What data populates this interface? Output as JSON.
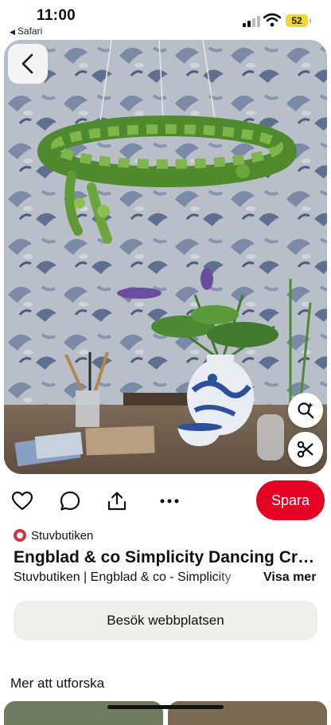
{
  "status_bar": {
    "time": "11:00",
    "back_app": "Safari",
    "battery": "52"
  },
  "pin": {
    "source_name": "Stuvbutiken",
    "title": "Engblad & co Simplicity Dancing Cra...",
    "description": "Stuvbutiken | Engblad & co - Simplicity",
    "more_label": "Visa mer",
    "save_label": "Spara",
    "visit_label": "Besök webbplatsen"
  },
  "section": {
    "explore_label": "Mer att utforska"
  },
  "icons": {
    "back": "chevron-left-icon",
    "lens": "visual-search-icon",
    "cut": "scissors-icon",
    "like": "heart-icon",
    "comment": "comment-icon",
    "share": "share-icon",
    "more": "ellipsis-icon"
  },
  "colors": {
    "save": "#e60023",
    "visit_button": "#efefed",
    "battery": "#f2d43b"
  }
}
